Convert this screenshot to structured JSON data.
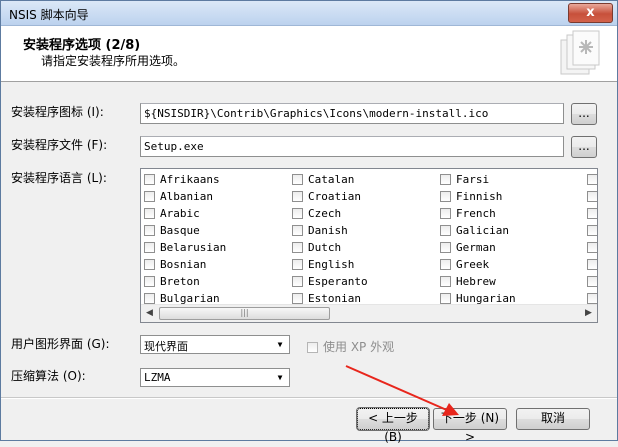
{
  "window": {
    "title": "NSIS 脚本向导",
    "close_label": "x"
  },
  "header": {
    "title": "安装程序选项 (2/8)",
    "subtitle": "请指定安装程序所用选项。"
  },
  "form": {
    "icon_label": "安装程序图标 (I):",
    "icon_value": "${NSISDIR}\\Contrib\\Graphics\\Icons\\modern-install.ico",
    "file_label": "安装程序文件 (F):",
    "file_value": "Setup.exe",
    "browse_label": "...",
    "lang_label": "安装程序语言 (L):",
    "languages": [
      [
        "Afrikaans",
        "Catalan",
        "Farsi"
      ],
      [
        "Albanian",
        "Croatian",
        "Finnish"
      ],
      [
        "Arabic",
        "Czech",
        "French"
      ],
      [
        "Basque",
        "Danish",
        "Galician"
      ],
      [
        "Belarusian",
        "Dutch",
        "German"
      ],
      [
        "Bosnian",
        "English",
        "Greek"
      ],
      [
        "Breton",
        "Esperanto",
        "Hebrew"
      ],
      [
        "Bulgarian",
        "Estonian",
        "Hungarian"
      ]
    ],
    "ui_label": "用户图形界面 (G):",
    "ui_value": "现代界面",
    "xp_label": "使用 XP 外观",
    "compress_label": "压缩算法 (O):",
    "compress_value": "LZMA"
  },
  "footer": {
    "back_label": "< 上一步 (B)",
    "next_label": "下一步 (N) >",
    "cancel_label": "取消"
  },
  "colors": {
    "annotation_arrow": "#e8261c"
  }
}
